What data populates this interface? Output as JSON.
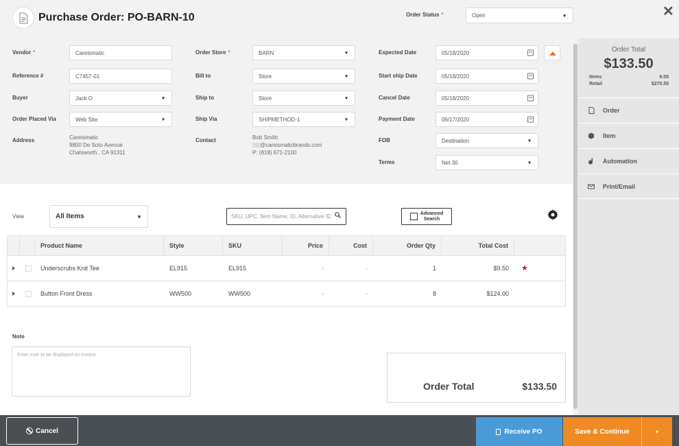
{
  "header": {
    "title": "Purchase Order: PO-BARN-10",
    "order_status_label": "Order Status",
    "required_mark": "*",
    "order_status_value": "Open",
    "close_glyph": "✕"
  },
  "form": {
    "vendor": {
      "label": "Vendor",
      "value": "Careismatic"
    },
    "reference": {
      "label": "Reference #",
      "value": "C7457-01"
    },
    "buyer": {
      "label": "Buyer",
      "value": "Jack O"
    },
    "order_placed_via": {
      "label": "Order Placed Via",
      "value": "Web Site"
    },
    "address": {
      "label": "Address",
      "line1": "Careismatic",
      "line2": "9800 De Soto Avenue",
      "line3": "Chatsworth , CA 91311"
    },
    "order_store": {
      "label": "Order Store",
      "value": "BARN"
    },
    "bill_to": {
      "label": "Bill to",
      "value": "Store"
    },
    "ship_to": {
      "label": "Ship to",
      "value": "Store"
    },
    "ship_via": {
      "label": "Ship Via",
      "value": "SHIPMETHOD-1"
    },
    "contact": {
      "label": "Contact",
      "name": "Bob Smith",
      "email": "@careismaticbrands.com",
      "phone": "P: (818) 671-2100"
    },
    "expected_date": {
      "label": "Expected Date",
      "value": "05/18/2020"
    },
    "start_ship_date": {
      "label": "Start ship Date",
      "value": "05/18/2020"
    },
    "cancel_date": {
      "label": "Cancel Date",
      "value": "05/18/2020"
    },
    "payment_date": {
      "label": "Payment Date",
      "value": "06/17/2020"
    },
    "fob": {
      "label": "FOB",
      "value": "Destination"
    },
    "terms": {
      "label": "Terms",
      "value": "Net 30"
    }
  },
  "sidebar": {
    "order_total_label": "Order Total",
    "order_total_value": "$133.50",
    "items_label": "Items",
    "items_value": "9.00",
    "retail_label": "Retail",
    "retail_value": "$275.55",
    "nav": [
      {
        "label": "Order",
        "icon": "document-icon"
      },
      {
        "label": "Item",
        "icon": "cube-icon"
      },
      {
        "label": "Automation",
        "icon": "automation-icon"
      },
      {
        "label": "Print/Email",
        "icon": "print-email-icon"
      }
    ]
  },
  "toolbar": {
    "view_label": "View",
    "view_value": "All Items",
    "search_placeholder": "SKU, UPC, Item Name, ID, Alternative IDs",
    "advanced_search_line1": "Advanced",
    "advanced_search_line2": "Search"
  },
  "table": {
    "headers": [
      "Product Name",
      "Style",
      "SKU",
      "Price",
      "Cost",
      "Order Qty",
      "Total Cost"
    ],
    "rows": [
      {
        "product": "Underscrubs Knit Tee",
        "style": "EL915",
        "sku": "EL915",
        "price": "-",
        "cost": "-",
        "qty": "1",
        "total": "$9.50",
        "starred": true
      },
      {
        "product": "Button Front Dress",
        "style": "WW500",
        "sku": "WW500",
        "price": "-",
        "cost": "-",
        "qty": "8",
        "total": "$124.00",
        "starred": false
      }
    ]
  },
  "note": {
    "label": "Note",
    "placeholder": "Enter note to be displayed on invoice."
  },
  "totals": {
    "label": "Order Total",
    "value": "$133.50"
  },
  "footer": {
    "cancel_label": "Cancel",
    "receive_label": "Receive PO",
    "save_label": "Save & Continue",
    "save_caret": "▾"
  },
  "colors": {
    "accent_orange": "#f08a24",
    "accent_blue": "#4a9ad8",
    "footer_bg": "#4a4f54",
    "star_red": "#c0151b"
  }
}
